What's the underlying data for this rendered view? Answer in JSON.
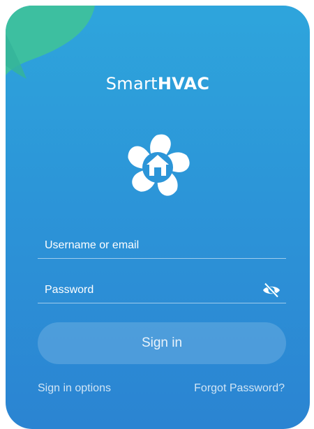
{
  "brand": {
    "name_light": "Smart",
    "name_bold": "HVAC"
  },
  "icons": {
    "leaf": "leaf-decoration-icon",
    "logo": "fan-house-logo-icon",
    "eye": "eye-slash-icon"
  },
  "colors": {
    "accent_green": "#3dbfa0",
    "background_top": "#2ea5dc",
    "background_bottom": "#2b84d2"
  },
  "form": {
    "username_placeholder": "Username or email",
    "password_placeholder": "Password",
    "signin_label": "Sign in"
  },
  "links": {
    "sign_in_options": "Sign in options",
    "forgot_password": "Forgot Password?"
  }
}
